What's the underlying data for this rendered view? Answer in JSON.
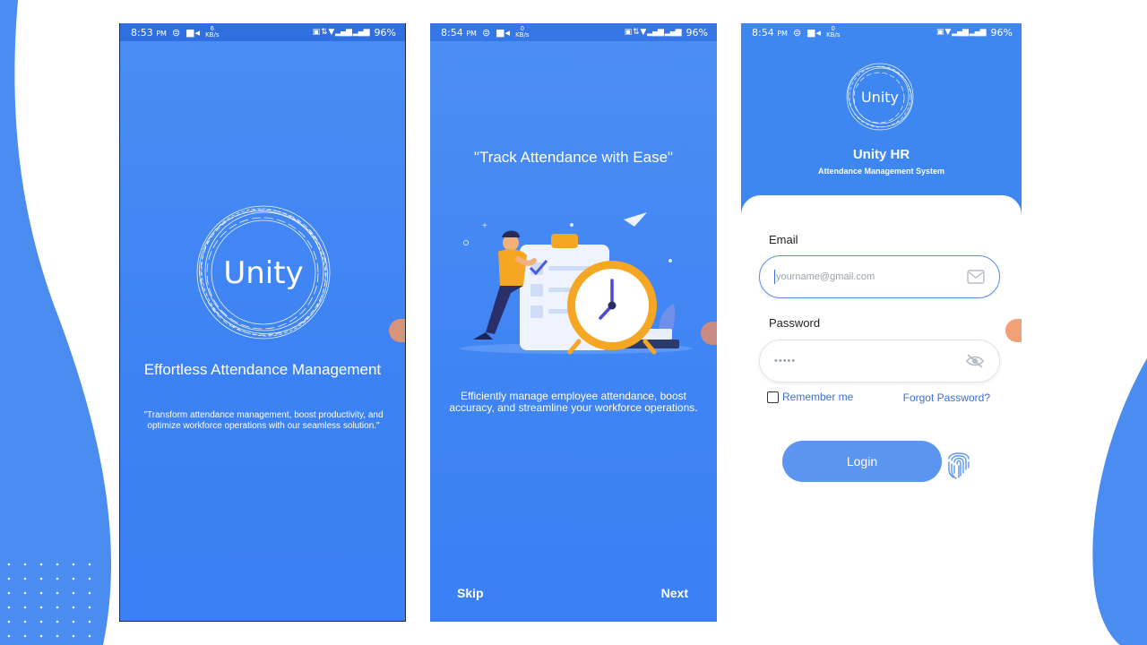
{
  "status_bars": [
    {
      "time": "8:53",
      "ampm": "PM",
      "speed": "6",
      "speed_unit": "KB/s",
      "battery": "96%"
    },
    {
      "time": "8:54",
      "ampm": "PM",
      "speed": "0",
      "speed_unit": "KB/s",
      "battery": "96%"
    },
    {
      "time": "8:54",
      "ampm": "PM",
      "speed": "0",
      "speed_unit": "KB/s",
      "battery": "96%"
    }
  ],
  "splash": {
    "logo_text": "Unity",
    "title": "Effortless Attendance Management",
    "quote": "\"Transform attendance management, boost productivity, and optimize workforce operations with our seamless solution.\""
  },
  "onboarding": {
    "title": "\"Track Attendance with Ease\"",
    "description": "Efficiently manage employee attendance, boost accuracy, and streamline your workforce operations.",
    "skip_label": "Skip",
    "next_label": "Next"
  },
  "login": {
    "logo_text": "Unity",
    "app_name": "Unity HR",
    "subtitle": "Attendance Management System",
    "email_label": "Email",
    "email_placeholder": "yourname@gmail.com",
    "password_label": "Password",
    "password_value": "•••••",
    "remember_label": "Remember me",
    "forgot_label": "Forgot Password?",
    "login_label": "Login"
  },
  "colors": {
    "brand_blue": "#3d82f3",
    "link_blue": "#3a6fd8",
    "button_blue": "#5b95ef",
    "accent_orange": "#f5a623"
  }
}
